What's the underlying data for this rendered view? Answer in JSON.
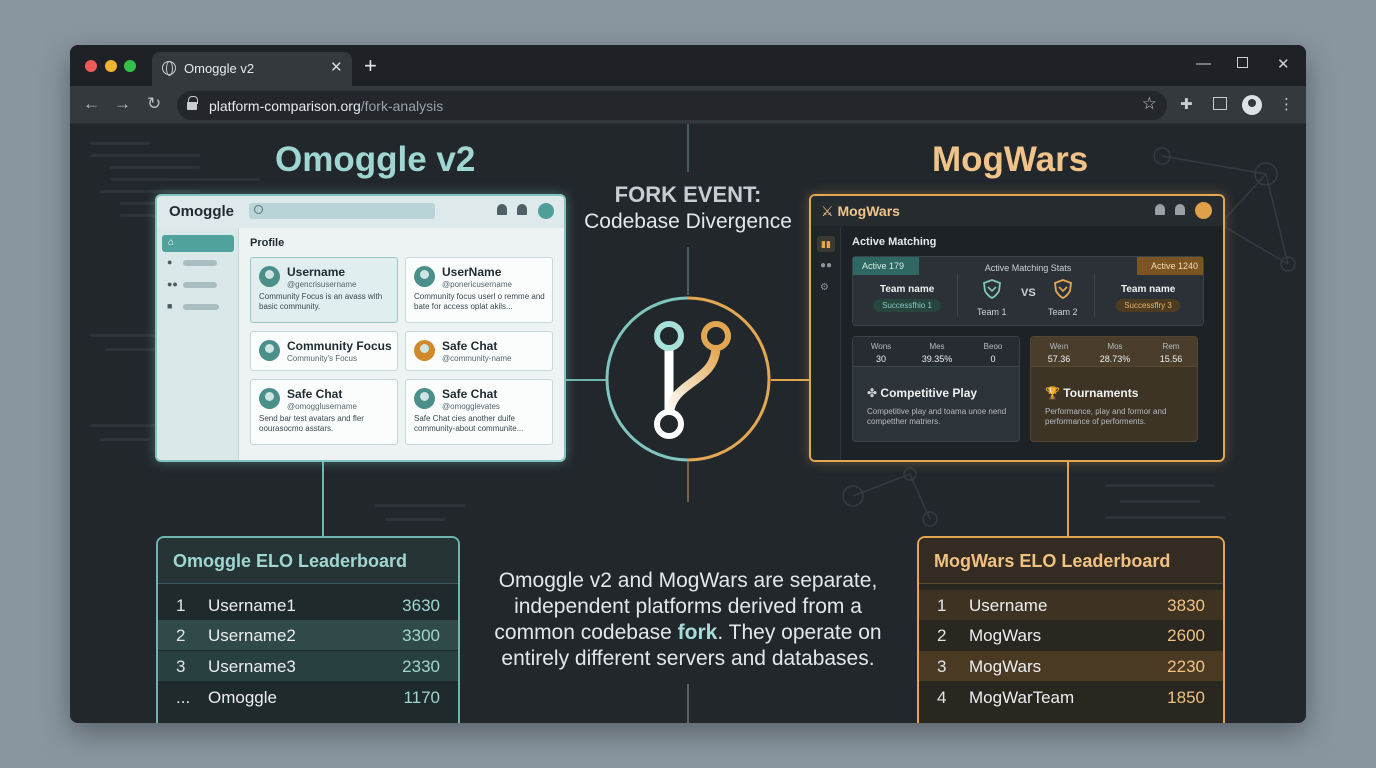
{
  "browser": {
    "tab_title": "Omoggle v2",
    "url_host": "platform-comparison.org",
    "url_path": "/fork-analysis"
  },
  "headings": {
    "left": "Omoggle v2",
    "right": "MogWars",
    "fork_line1": "FORK EVENT:",
    "fork_line2": "Codebase Divergence"
  },
  "omoggle_app": {
    "logo": "Omoggle",
    "section_label": "Profile",
    "cards": [
      {
        "name": "Username",
        "handle": "@gencrisusername",
        "desc": "Community Focus is an avass with basic community."
      },
      {
        "name": "UserName",
        "handle": "@ponericusername",
        "desc": "Community focus userl o remme and bate for access oplat akils..."
      },
      {
        "name": "Community Focus",
        "handle": "Community's Focus",
        "desc": ""
      },
      {
        "name": "Safe Chat",
        "handle": "@community-name",
        "desc": ""
      },
      {
        "name": "Safe Chat",
        "handle": "@omogglusername",
        "desc": "Send bar test avatars and fler oourasocmo asstars."
      },
      {
        "name": "Safe Chat",
        "handle": "@omogglevates",
        "desc": "Safe Chat cies another duife community-about communite..."
      }
    ]
  },
  "mogwars_app": {
    "logo": "MogWars",
    "section_label": "Active Matching",
    "stats": {
      "badge_left": "Active 179",
      "badge_right": "Active 1240",
      "title": "Active Matching Stats",
      "team_name_left": "Team name",
      "team_name_right": "Team name",
      "success_left": "Successfhio 1",
      "success_right": "Successflry 3",
      "team1": "Team 1",
      "team2": "Team 2",
      "vs": "VS"
    },
    "boxes": [
      {
        "metrics": [
          {
            "h": "Wons",
            "v": "30"
          },
          {
            "h": "Mes",
            "v": "39.35%"
          },
          {
            "h": "Beoo",
            "v": "0"
          }
        ],
        "title": "Competitive Play",
        "desc": "Competitive play and toama unoe nend competther matriers."
      },
      {
        "metrics": [
          {
            "h": "Weın",
            "v": "57.36"
          },
          {
            "h": "Mos",
            "v": "28.73%"
          },
          {
            "h": "Rem",
            "v": "15.56"
          }
        ],
        "title": "Tournaments",
        "desc": "Performance, play and formor and performance of performents."
      }
    ]
  },
  "leaderboards": {
    "omoggle": {
      "title": "Omoggle ELO Leaderboard",
      "rows": [
        {
          "rank": "1",
          "name": "Username1",
          "score": "3630"
        },
        {
          "rank": "2",
          "name": "Username2",
          "score": "3300"
        },
        {
          "rank": "3",
          "name": "Username3",
          "score": "2330"
        },
        {
          "rank": "...",
          "name": "Omoggle",
          "score": "1170"
        }
      ]
    },
    "mogwars": {
      "title": "MogWars ELO Leaderboard",
      "rows": [
        {
          "rank": "1",
          "name": "Username",
          "score": "3830"
        },
        {
          "rank": "2",
          "name": "MogWars",
          "score": "2600"
        },
        {
          "rank": "3",
          "name": "MogWars",
          "score": "2230"
        },
        {
          "rank": "4",
          "name": "MogWarTeam",
          "score": "1850"
        }
      ]
    }
  },
  "description": {
    "part1": "Omoggle v2 and MogWars are separate, independent platforms derived from a common codebase",
    "highlight": "fork",
    "part2": ". They operate on entirely different servers and databases."
  },
  "colors": {
    "teal_accent": "#7fc4bd",
    "gold_accent": "#e2a752",
    "background": "#22272c"
  },
  "icons": [
    "globe-icon",
    "close-icon",
    "plus-icon",
    "minimize-icon",
    "maximize-icon",
    "back-icon",
    "forward-icon",
    "reload-icon",
    "lock-icon",
    "star-icon",
    "puzzle-icon",
    "sidepanel-icon",
    "profile-icon",
    "kebab-menu-icon",
    "fork-branch-icon",
    "shield-icon",
    "trophy-icon",
    "swords-icon",
    "bell-icon",
    "home-icon"
  ]
}
